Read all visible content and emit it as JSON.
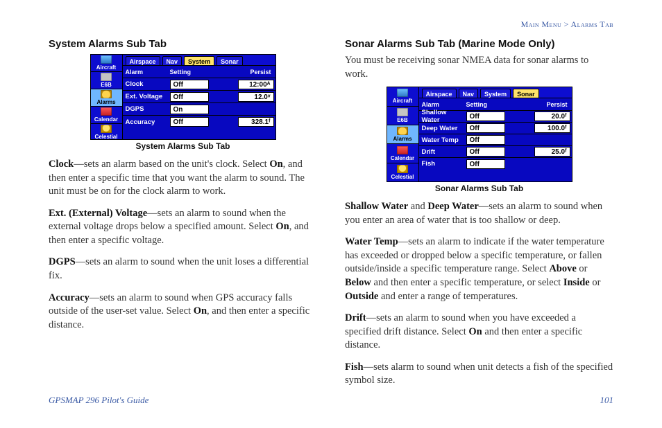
{
  "breadcrumb": {
    "left": "Main Menu",
    "sep": ">",
    "right": "Alarms Tab"
  },
  "left": {
    "title": "System Alarms Sub Tab",
    "caption": "System Alarms Sub Tab",
    "screenshot": {
      "sidebar": [
        {
          "label": "Aircraft",
          "icon": "globe-icon"
        },
        {
          "label": "E6B",
          "icon": "e6b-icon"
        },
        {
          "label": "Alarms",
          "icon": "alarm-icon",
          "selected": true
        },
        {
          "label": "Calendar",
          "icon": "calendar-icon"
        },
        {
          "label": "Celestial",
          "icon": "celestial-icon"
        }
      ],
      "tabs": [
        "Airspace",
        "Nav",
        "System",
        "Sonar"
      ],
      "selected_tab": "System",
      "columns": [
        "Alarm",
        "Setting",
        "Persist"
      ],
      "rows": [
        {
          "alarm": "Clock",
          "setting": "Off",
          "value": "12:00ᴬ"
        },
        {
          "alarm": "Ext. Voltage",
          "setting": "Off",
          "value": "12.0ᵛ"
        },
        {
          "alarm": "DGPS",
          "setting": "On",
          "value": ""
        },
        {
          "alarm": "Accuracy",
          "setting": "Off",
          "value": "328.1ᶠ"
        }
      ]
    },
    "paras": {
      "clock": {
        "term": "Clock",
        "body": "—sets an alarm based on the unit's clock. Select ",
        "mid_bold": "On",
        "tail": ", and then enter a specific time that you want the alarm to sound. The unit must be on for the clock alarm to work."
      },
      "ext": {
        "term": "Ext. (External) Voltage",
        "body": "—sets an alarm to sound when the external voltage drops below a specified amount. Select ",
        "mid_bold": "On",
        "tail": ", and then enter a specific voltage."
      },
      "dgps": {
        "term": "DGPS",
        "body": "—sets an alarm to sound when the unit loses a differential fix."
      },
      "acc": {
        "term": "Accuracy",
        "body": "—sets an alarm to sound when GPS accuracy falls outside of the user-set value. Select ",
        "mid_bold": "On",
        "tail": ", and then enter a specific distance."
      }
    }
  },
  "right": {
    "title": "Sonar Alarms Sub Tab (Marine Mode Only)",
    "intro": "You must be receiving sonar NMEA data for sonar alarms to work.",
    "caption": "Sonar Alarms Sub Tab",
    "screenshot": {
      "sidebar": [
        {
          "label": "Aircraft",
          "icon": "globe-icon"
        },
        {
          "label": "E6B",
          "icon": "e6b-icon"
        },
        {
          "label": "Alarms",
          "icon": "alarm-icon",
          "selected": true
        },
        {
          "label": "Calendar",
          "icon": "calendar-icon"
        },
        {
          "label": "Celestial",
          "icon": "celestial-icon"
        }
      ],
      "tabs": [
        "Airspace",
        "Nav",
        "System",
        "Sonar"
      ],
      "selected_tab": "Sonar",
      "columns": [
        "Alarm",
        "Setting",
        "Persist"
      ],
      "rows": [
        {
          "alarm": "Shallow Water",
          "setting": "Off",
          "value": "20.0ᶠ"
        },
        {
          "alarm": "Deep Water",
          "setting": "Off",
          "value": "100.0ᶠ"
        },
        {
          "alarm": "Water Temp",
          "setting": "Off",
          "value": ""
        },
        {
          "alarm": "Drift",
          "setting": "Off",
          "value": "25.0ᶠ"
        },
        {
          "alarm": "Fish",
          "setting": "Off",
          "value": ""
        }
      ]
    },
    "paras": {
      "water": {
        "term1": "Shallow Water",
        "joiner": " and ",
        "term2": "Deep Water",
        "body": "—sets an alarm to sound when you enter an area of water that is too shallow or deep."
      },
      "temp": {
        "term": "Water Temp",
        "body": "—sets an alarm to indicate if the water temperature has exceeded or dropped below a specific temperature, or fallen outside/inside a specific temperature range. Select ",
        "b1": "Above",
        "m1": " or ",
        "b2": "Below",
        "m2": " and then enter a specific temperature, or select ",
        "b3": "Inside",
        "m3": " or ",
        "b4": "Outside",
        "tail": " and enter a range of temperatures."
      },
      "drift": {
        "term": "Drift",
        "body": "—sets an alarm to sound when you have exceeded a specified drift distance. Select ",
        "mid_bold": "On",
        "tail": " and then enter a specific distance."
      },
      "fish": {
        "term": "Fish",
        "body": "—sets alarm to sound when unit detects a fish of the specified symbol size."
      }
    }
  },
  "footer": {
    "guide": "GPSMAP 296 Pilot's Guide",
    "page": "101"
  }
}
